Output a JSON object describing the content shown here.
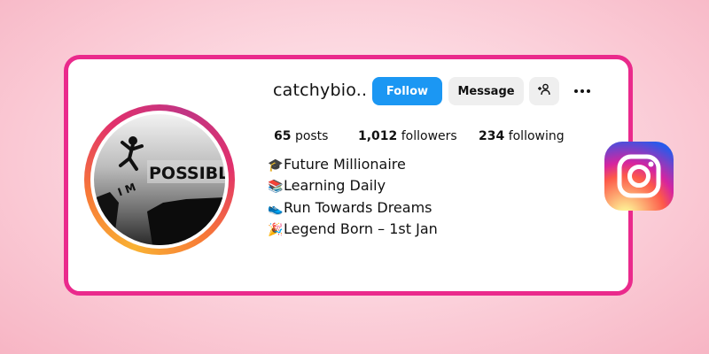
{
  "profile": {
    "username": "catchybio..",
    "avatar_text": "POSSIBLE",
    "avatar_letters": "I M",
    "follow_label": "Follow",
    "message_label": "Message",
    "add_user_icon": "add-user-icon",
    "more_icon": "more-options-icon"
  },
  "stats": {
    "posts_count": "65",
    "posts_label": "posts",
    "followers_count": "1,012",
    "followers_label": "followers",
    "following_count": "234",
    "following_label": "following"
  },
  "bio": [
    {
      "emoji": "🎓",
      "text": "Future Millionaire"
    },
    {
      "emoji": "📚",
      "text": "Learning Daily"
    },
    {
      "emoji": "👟",
      "text": "Run Towards Dreams"
    },
    {
      "emoji": "🎉",
      "text": "Legend Born – 1st Jan"
    }
  ],
  "colors": {
    "card_border": "#ea2a8c",
    "follow_button": "#1b97f3",
    "secondary_button": "#efefef"
  },
  "logo": "instagram-logo"
}
